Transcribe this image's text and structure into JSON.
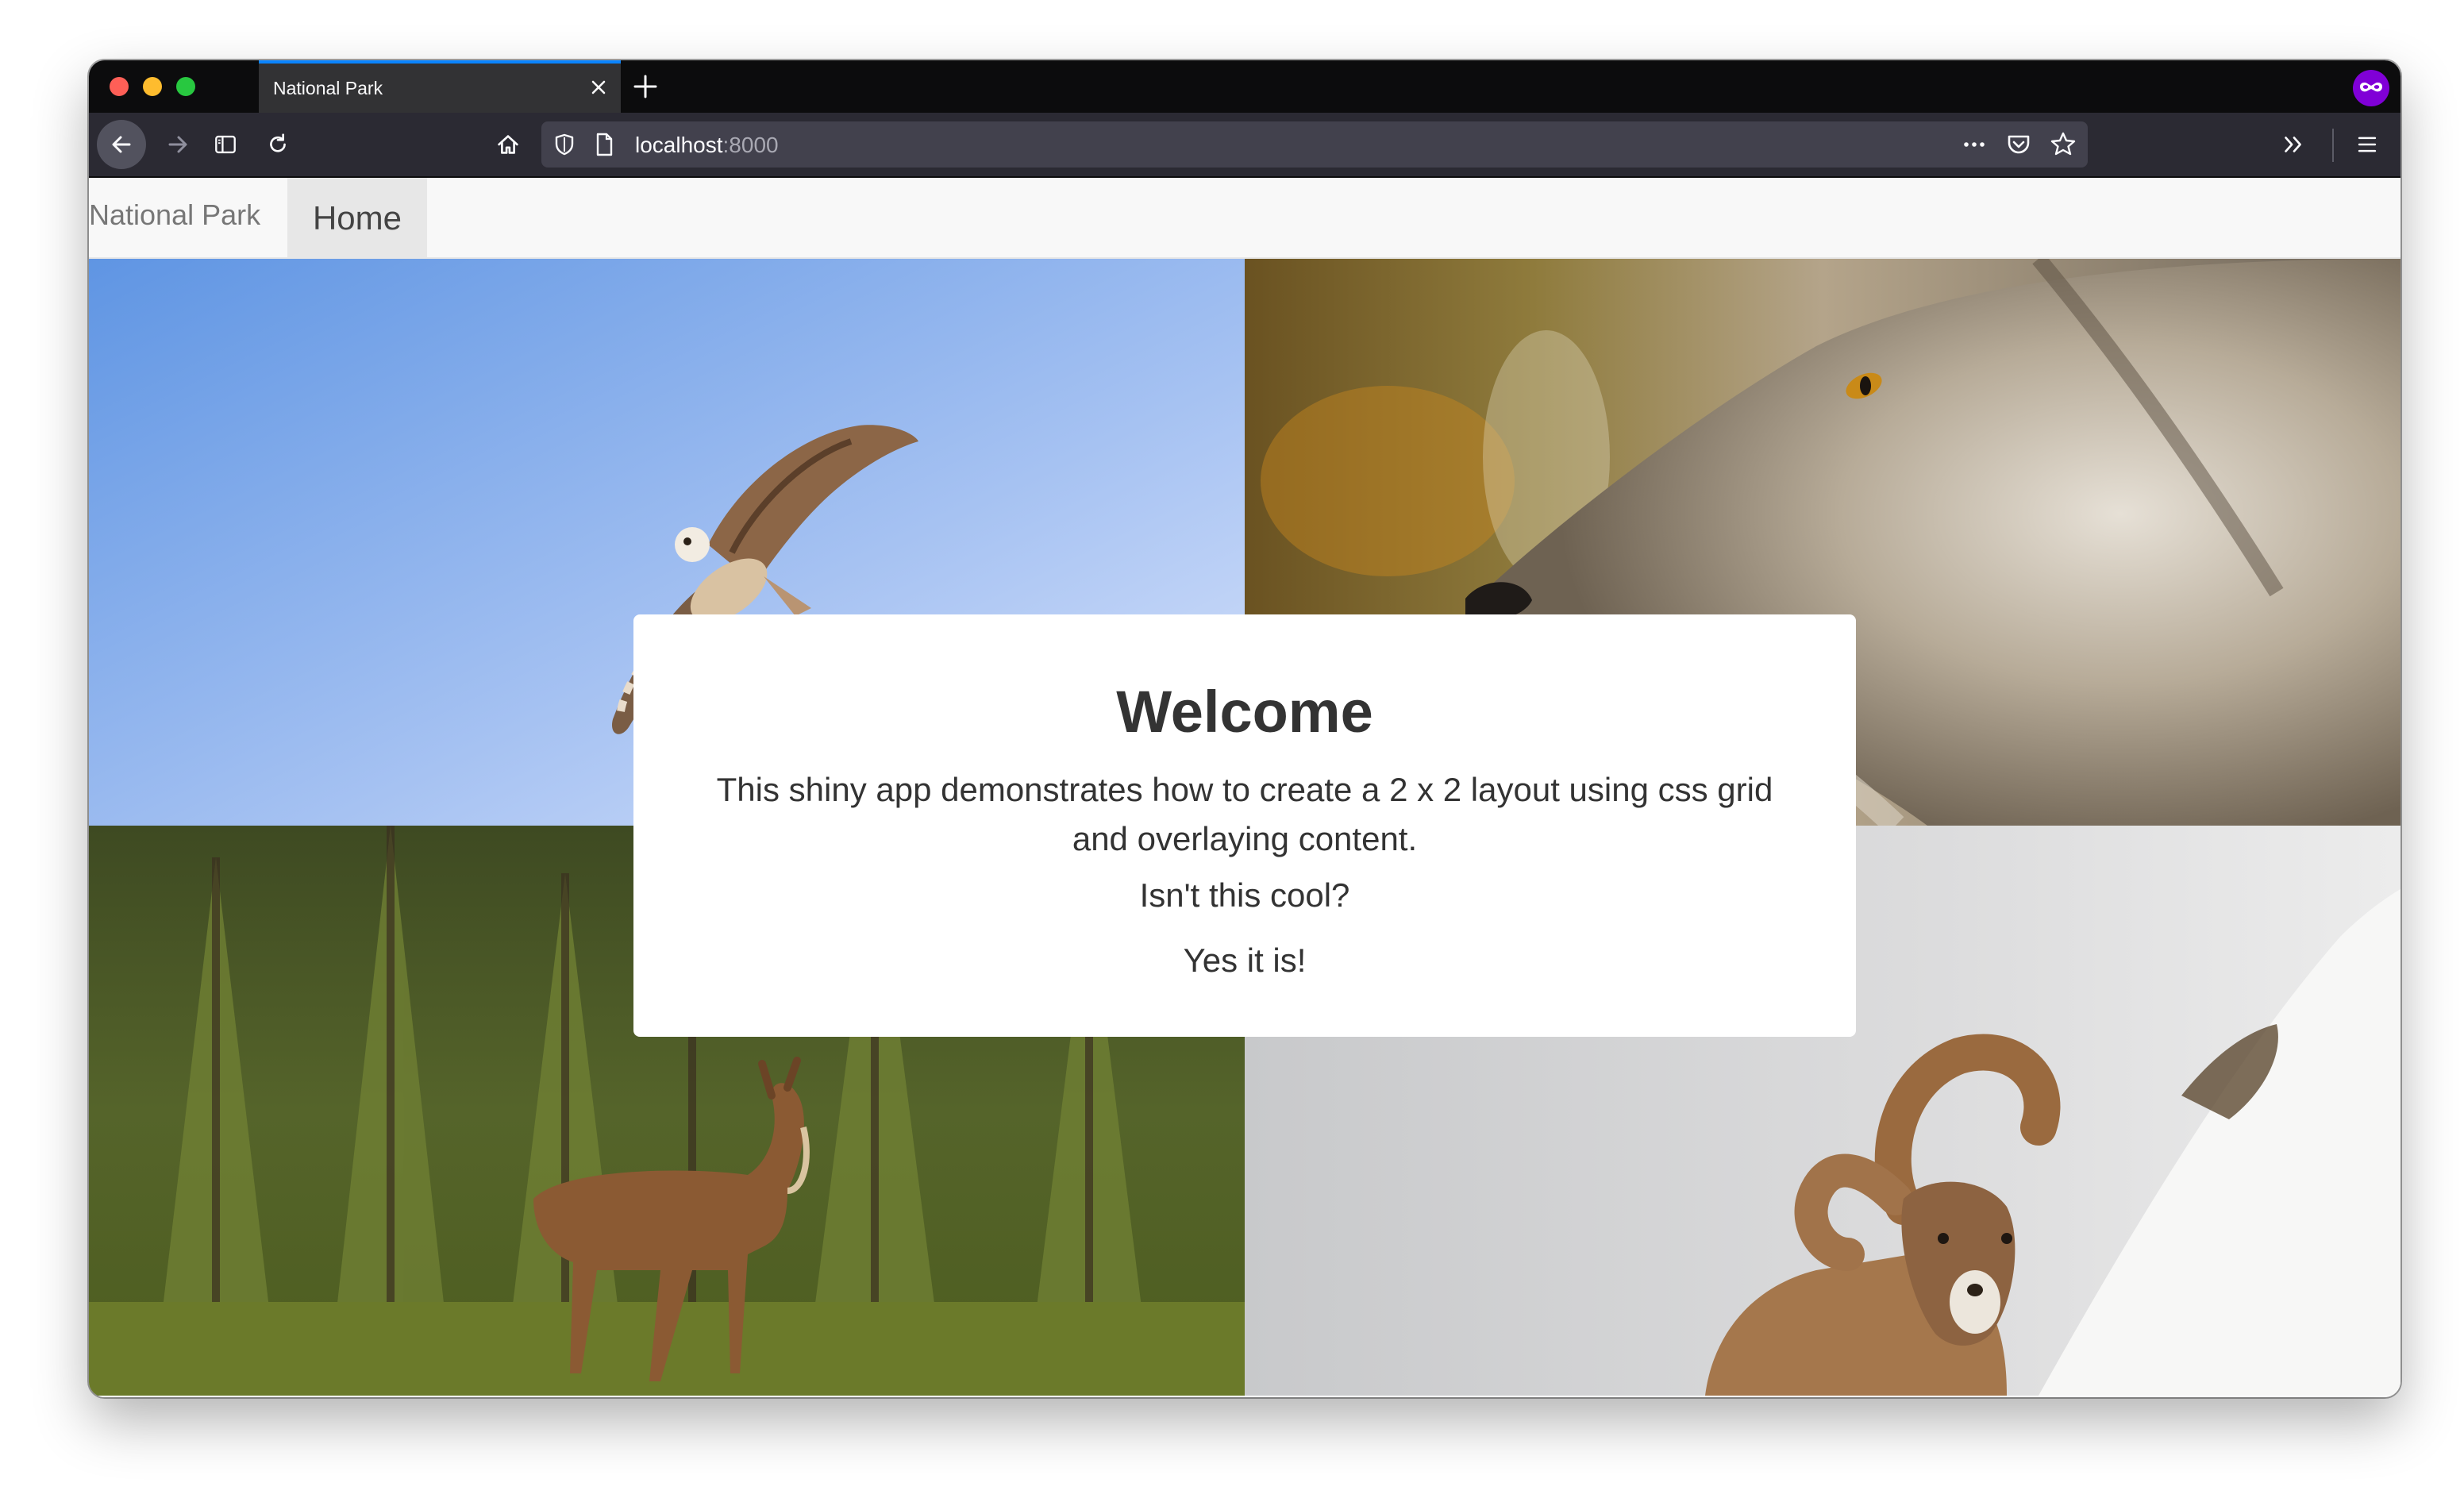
{
  "browser": {
    "tab_title": "National Park",
    "url_host": "localhost",
    "url_port": ":8000"
  },
  "app": {
    "brand": "National Park",
    "nav_home": "Home"
  },
  "overlay": {
    "title": "Welcome",
    "description": "This shiny app demonstrates how to create a 2 x 2 layout using css grid and overlaying content.",
    "question": "Isn't this cool?",
    "answer": "Yes it is!"
  },
  "grid_images": [
    {
      "subject": "osprey"
    },
    {
      "subject": "wolf"
    },
    {
      "subject": "elk"
    },
    {
      "subject": "bighorn-sheep"
    }
  ],
  "icons": {
    "back": "back-arrow-icon",
    "forward": "forward-arrow-icon",
    "sidebar": "sidebar-icon",
    "reload": "reload-icon",
    "home": "home-icon",
    "shield": "shield-icon",
    "page": "page-icon",
    "more": "more-dots-icon",
    "pocket": "pocket-icon",
    "bookmark": "star-icon",
    "overflow": "chevrons-icon",
    "menu": "hamburger-icon",
    "private": "private-mask-icon"
  }
}
